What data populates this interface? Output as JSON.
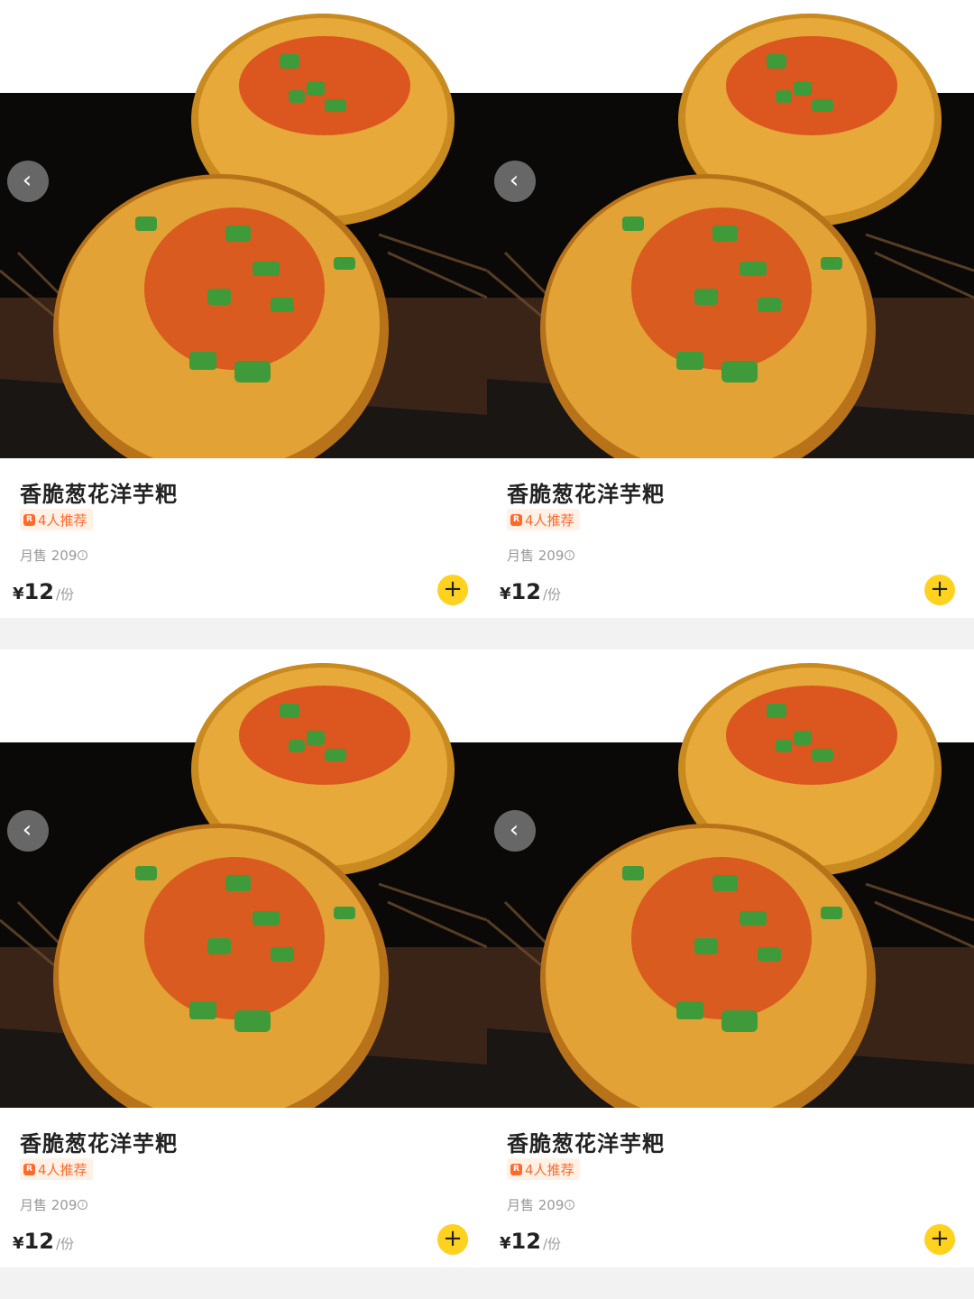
{
  "colors": {
    "accent_yellow": "#ffd21f",
    "tag_orange": "#ff6a2b",
    "tag_bg": "#fff1e6",
    "muted_text": "#999999",
    "title_text": "#222222"
  },
  "cards": [
    {
      "name": "香脆葱花洋芋粑",
      "tag": "4人推荐",
      "tag_icon": "R",
      "sales": "月售 209",
      "currency": "¥",
      "price": "12",
      "unit": "/份",
      "back_icon": "‹",
      "add_icon": "+"
    },
    {
      "name": "香脆葱花洋芋粑",
      "tag": "4人推荐",
      "tag_icon": "R",
      "sales": "月售 209",
      "currency": "¥",
      "price": "12",
      "unit": "/份",
      "back_icon": "‹",
      "add_icon": "+"
    },
    {
      "name": "香脆葱花洋芋粑",
      "tag": "4人推荐",
      "tag_icon": "R",
      "sales": "月售 209",
      "currency": "¥",
      "price": "12",
      "unit": "/份",
      "back_icon": "‹",
      "add_icon": "+"
    },
    {
      "name": "香脆葱花洋芋粑",
      "tag": "4人推荐",
      "tag_icon": "R",
      "sales": "月售 209",
      "currency": "¥",
      "price": "12",
      "unit": "/份",
      "back_icon": "‹",
      "add_icon": "+"
    }
  ]
}
